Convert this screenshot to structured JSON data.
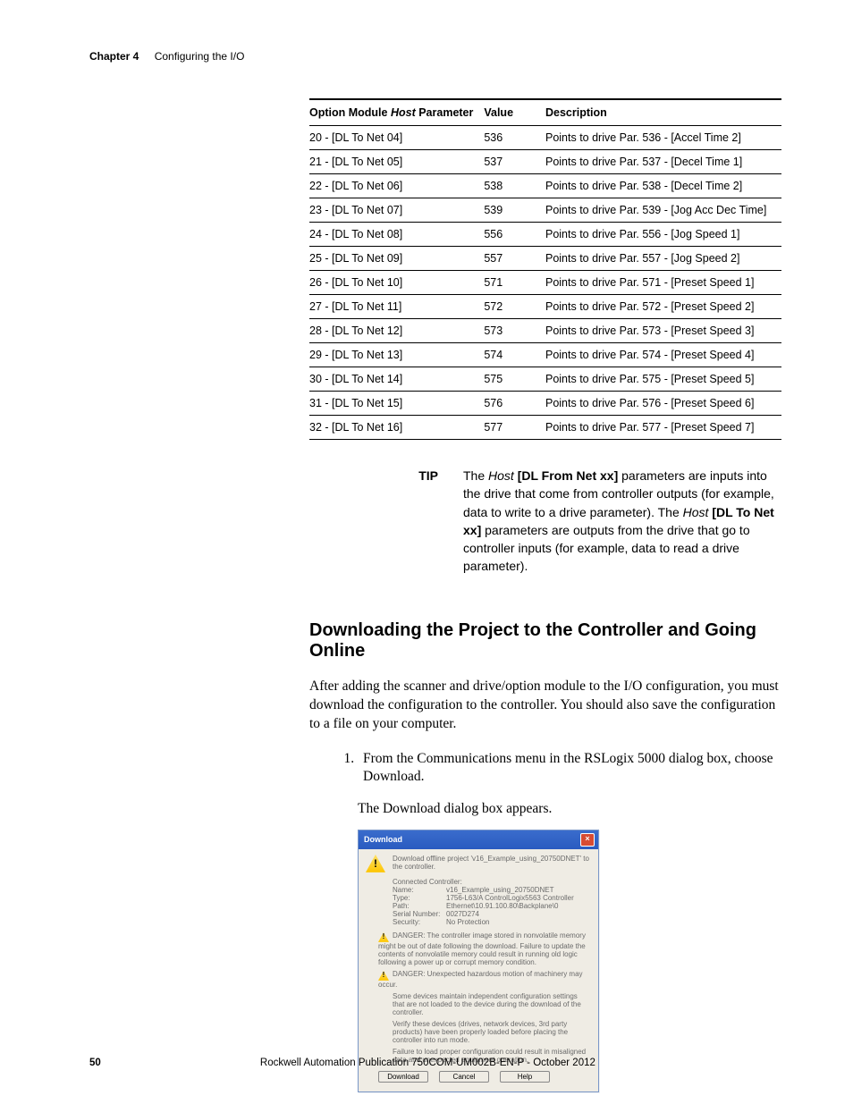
{
  "header": {
    "chapter": "Chapter 4",
    "title": "Configuring the I/O"
  },
  "table": {
    "headers": {
      "param_pre": "Option Module ",
      "param_it": "Host",
      "param_post": " Parameter",
      "value": "Value",
      "desc": "Description"
    },
    "rows": [
      {
        "p": "20 - [DL To Net 04]",
        "v": "536",
        "d": "Points to drive Par. 536 - [Accel Time 2]"
      },
      {
        "p": "21 - [DL To Net 05]",
        "v": "537",
        "d": "Points to drive Par. 537 - [Decel Time 1]"
      },
      {
        "p": "22 - [DL To Net 06]",
        "v": "538",
        "d": "Points to drive Par. 538 - [Decel Time 2]"
      },
      {
        "p": "23 - [DL To Net 07]",
        "v": "539",
        "d": "Points to drive Par. 539 - [Jog Acc Dec Time]"
      },
      {
        "p": "24 - [DL To Net 08]",
        "v": "556",
        "d": "Points to drive Par. 556 - [Jog Speed 1]"
      },
      {
        "p": "25 - [DL To Net 09]",
        "v": "557",
        "d": "Points to drive Par. 557 - [Jog Speed 2]"
      },
      {
        "p": "26 - [DL To Net 10]",
        "v": "571",
        "d": "Points to drive Par. 571 - [Preset Speed 1]"
      },
      {
        "p": "27 - [DL To Net 11]",
        "v": "572",
        "d": "Points to drive Par. 572 - [Preset Speed 2]"
      },
      {
        "p": "28 - [DL To Net 12]",
        "v": "573",
        "d": "Points to drive Par. 573 - [Preset Speed 3]"
      },
      {
        "p": "29 - [DL To Net 13]",
        "v": "574",
        "d": "Points to drive Par. 574 - [Preset Speed 4]"
      },
      {
        "p": "30 - [DL To Net 14]",
        "v": "575",
        "d": "Points to drive Par. 575 - [Preset Speed 5]"
      },
      {
        "p": "31 - [DL To Net 15]",
        "v": "576",
        "d": "Points to drive Par. 576 - [Preset Speed 6]"
      },
      {
        "p": "32 - [DL To Net 16]",
        "v": "577",
        "d": "Points to drive Par. 577 - [Preset Speed 7]"
      }
    ]
  },
  "tip": {
    "label": "TIP",
    "t1": "The ",
    "i1": "Host",
    "b1": " [DL From Net xx]",
    "t2": " parameters are inputs into the drive that come from controller outputs (for example, data to write to a drive parameter). The ",
    "i2": "Host",
    "b2": " [DL To Net xx]",
    "t3": " parameters are outputs from the drive that go to controller inputs (for example, data to read a drive parameter)."
  },
  "section_heading": "Downloading the Project to the Controller and Going Online",
  "intro": "After adding the scanner and drive/option module to the I/O configuration, you must download the configuration to the controller. You should also save the configuration to a file on your computer.",
  "step1": "From the Communications menu in the RSLogix 5000 dialog box, choose Download.",
  "step1b": "The Download dialog box appears.",
  "dialog": {
    "title": "Download",
    "close": "×",
    "line1": "Download offline project 'v16_Example_using_20750DNET' to the controller.",
    "conn_label": "Connected Controller:",
    "kv": [
      {
        "k": "Name:",
        "v": "v16_Example_using_20750DNET"
      },
      {
        "k": "Type:",
        "v": "1756-L63/A ControlLogix5563 Controller"
      },
      {
        "k": "Path:",
        "v": "Ethernet\\10.91.100.80\\Backplane\\0"
      },
      {
        "k": "Serial Number:",
        "v": "0027D274"
      },
      {
        "k": "Security:",
        "v": "No Protection"
      }
    ],
    "danger1": "DANGER: The controller image stored in nonvolatile memory might be out of date following the download. Failure to update the contents of nonvolatile memory could result in running old logic following a power up or corrupt memory condition.",
    "danger2": "DANGER: Unexpected hazardous motion of machinery may occur.",
    "p3": "Some devices maintain independent configuration settings that are not loaded to the device during the download of the controller.",
    "p4": "Verify these devices (drives, network devices, 3rd party products) have been properly loaded before placing the controller into run mode.",
    "p5": "Failure to load proper configuration could result in misaligned data and unexpected equipment operation.",
    "btn_download": "Download",
    "btn_cancel": "Cancel",
    "btn_help": "Help"
  },
  "footer": {
    "page": "50",
    "pub": "Rockwell Automation Publication 750COM-UM002B-EN-P - October 2012"
  }
}
